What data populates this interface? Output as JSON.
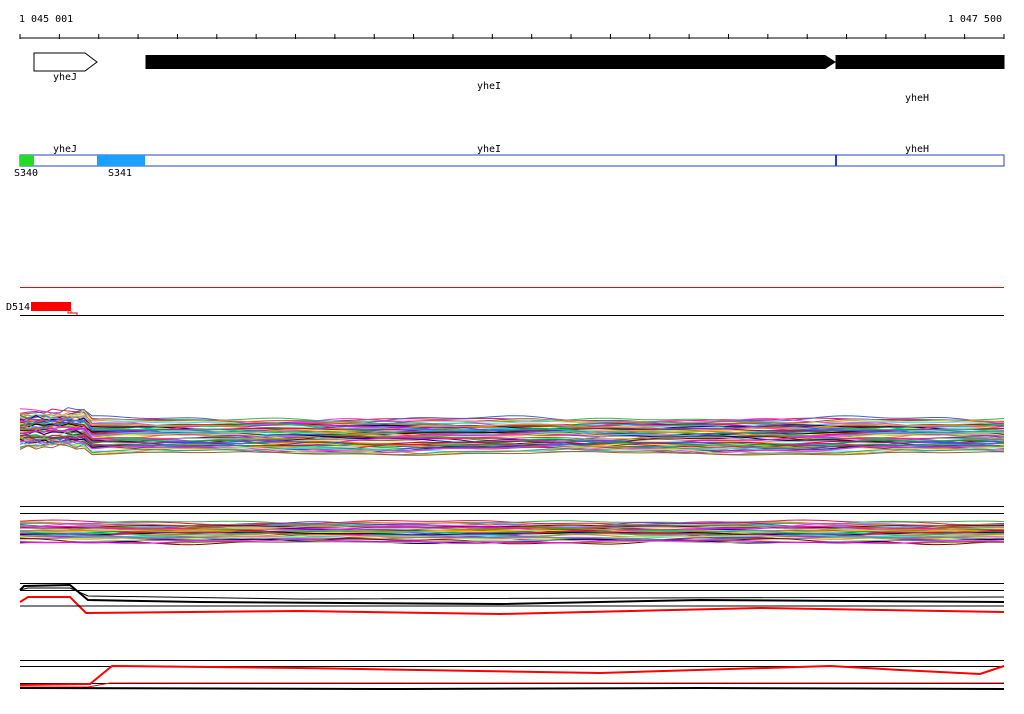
{
  "coords": {
    "start_label": "1 045 001",
    "end_label": "1 047 500",
    "start": 1045001,
    "end": 1047500
  },
  "genes": [
    {
      "name": "yheJ",
      "start": 1045040,
      "end": 1045200,
      "strand": "+",
      "fill": "#ffffff"
    },
    {
      "name": "yheI",
      "start": 1045320,
      "end": 1047075,
      "strand": "+",
      "fill": "#000000"
    },
    {
      "name": "yheH",
      "start": 1047075,
      "end": 1047500,
      "strand": "+",
      "fill": "#000000"
    }
  ],
  "segments": [
    {
      "label": "S340",
      "start": 1045001,
      "end": 1045040,
      "color": "#22dd22"
    },
    {
      "label": "S341",
      "start": 1045200,
      "end": 1045320,
      "color": "#1aa0ff"
    }
  ],
  "transcript_labels": [
    "yheJ",
    "yheI",
    "yheH"
  ],
  "deletion": {
    "label": "D514",
    "start": 1045030,
    "end": 1045130,
    "color": "#ff0000"
  },
  "colors": {
    "axis": "#000000",
    "bar_outline": "#2040c0",
    "red": "#ff0000"
  }
}
